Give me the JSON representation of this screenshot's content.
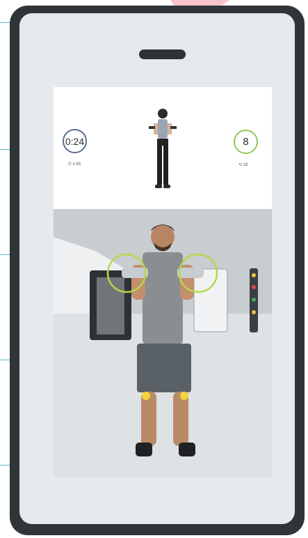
{
  "app": {
    "title": "",
    "accent_ring_timer": "#5a6c8f",
    "accent_ring_reps": "#8fc65a",
    "joint_marker_color": "#f5d23a"
  },
  "workout": {
    "timer_value": "0:24",
    "timer_sub": "⏱ 2:45",
    "timer_progress": 0.15,
    "reps_value": "8",
    "reps_sub": "⟲ 18",
    "reps_progress": 0.44
  },
  "icons": {
    "timer": "stopwatch-icon",
    "reps": "repeat-icon"
  },
  "device": {
    "type": "smart-fitness-mirror",
    "color": "#2f3539"
  }
}
